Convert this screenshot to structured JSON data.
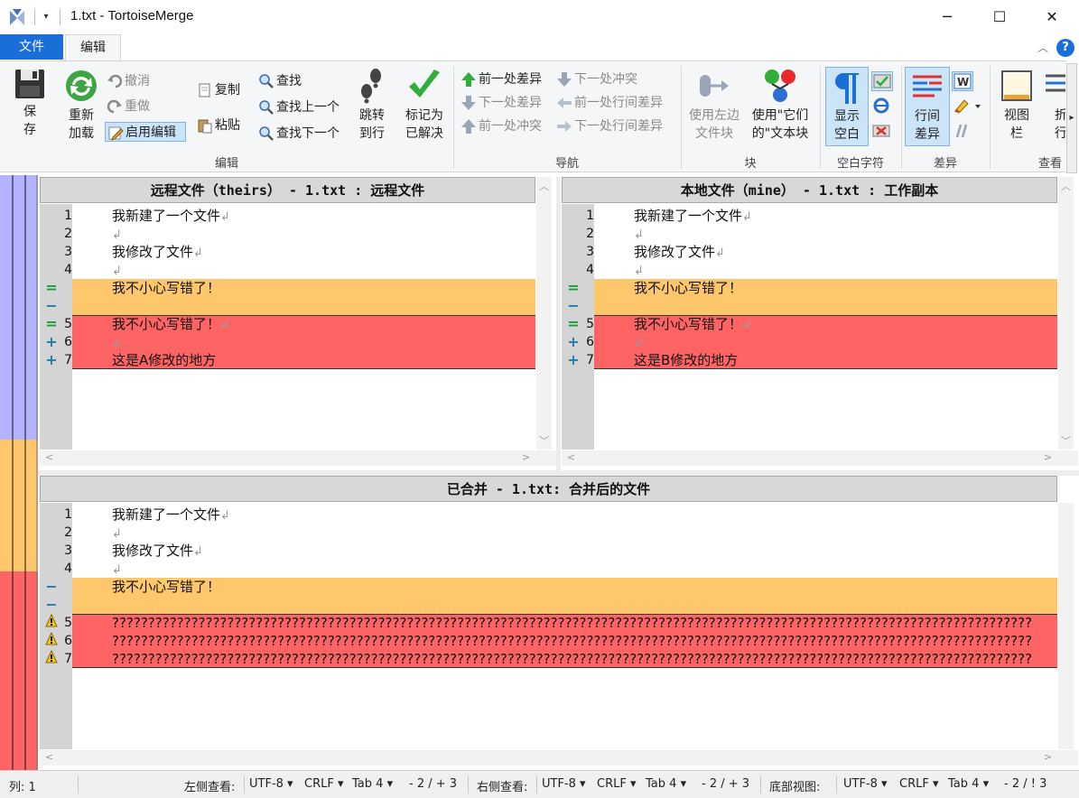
{
  "window": {
    "title": "1.txt - TortoiseMerge",
    "quick_access_dropdown": "▾",
    "minimize": "─",
    "maximize": "☐",
    "close": "✕"
  },
  "ribbon_tabs": {
    "file": "文件",
    "edit": "编辑",
    "help": "?"
  },
  "ribbon": {
    "edit_group": {
      "label": "编辑",
      "save": "保\n存",
      "reload": "重新\n加载",
      "undo": "撤消",
      "redo": "重做",
      "enable_edit": "启用编辑",
      "copy": "复制",
      "paste": "粘贴",
      "find": "查找",
      "find_prev": "查找上一个",
      "find_next": "查找下一个",
      "goto_line": "跳转\n到行",
      "mark_resolved": "标记为\n已解决"
    },
    "nav_group": {
      "label": "导航",
      "prev_diff": "前一处差异",
      "next_diff": "下一处差异",
      "prev_conflict": "前一处冲突",
      "next_conflict": "下一处冲突",
      "prev_inline_diff": "前一处行间差异",
      "next_inline_diff": "下一处行间差异"
    },
    "block_group": {
      "label": "块",
      "use_left": "使用左边\n文件块",
      "use_theirs": "使用\"它们\n的\"文本块"
    },
    "whitespace_group": {
      "label": "空白字符",
      "show_whitespace": "显示\n空白"
    },
    "diff_group": {
      "label": "差异",
      "inline_diff": "行间\n差异"
    },
    "view_group": {
      "label": "查看",
      "view_bar": "视图\n栏",
      "fold": "折\n行"
    }
  },
  "panes": {
    "left": {
      "header": "远程文件（theirs） - 1.txt : 远程文件",
      "lines": [
        {
          "mark": "",
          "num": "1",
          "text": "我新建了一个文件",
          "eol": "↲",
          "bg": ""
        },
        {
          "mark": "",
          "num": "2",
          "text": "",
          "eol": "↲",
          "bg": ""
        },
        {
          "mark": "",
          "num": "3",
          "text": "我修改了文件",
          "eol": "↲",
          "bg": ""
        },
        {
          "mark": "",
          "num": "4",
          "text": "",
          "eol": "↲",
          "bg": ""
        },
        {
          "mark": "=",
          "num": "",
          "text": "我不小心写错了！",
          "eol": "",
          "bg": "orange"
        },
        {
          "mark": "−",
          "num": "",
          "text": "",
          "eol": "",
          "bg": "orange"
        },
        {
          "mark": "=",
          "num": "5",
          "text": "我不小心写错了！",
          "eol": "↲",
          "bg": "red"
        },
        {
          "mark": "+",
          "num": "6",
          "text": "",
          "eol": "↲",
          "bg": "red"
        },
        {
          "mark": "+",
          "num": "7",
          "text": "这是A修改的地方",
          "eol": "",
          "bg": "red"
        }
      ]
    },
    "right": {
      "header": "本地文件（mine） - 1.txt : 工作副本",
      "lines": [
        {
          "mark": "",
          "num": "1",
          "text": "我新建了一个文件",
          "eol": "↲",
          "bg": ""
        },
        {
          "mark": "",
          "num": "2",
          "text": "",
          "eol": "↲",
          "bg": ""
        },
        {
          "mark": "",
          "num": "3",
          "text": "我修改了文件",
          "eol": "↲",
          "bg": ""
        },
        {
          "mark": "",
          "num": "4",
          "text": "",
          "eol": "↲",
          "bg": ""
        },
        {
          "mark": "=",
          "num": "",
          "text": "我不小心写错了！",
          "eol": "",
          "bg": "orange"
        },
        {
          "mark": "−",
          "num": "",
          "text": "",
          "eol": "",
          "bg": "orange"
        },
        {
          "mark": "=",
          "num": "5",
          "text": "我不小心写错了！",
          "eol": "↲",
          "bg": "red"
        },
        {
          "mark": "+",
          "num": "6",
          "text": "",
          "eol": "↲",
          "bg": "red"
        },
        {
          "mark": "+",
          "num": "7",
          "text": "这是B修改的地方",
          "eol": "",
          "bg": "red"
        }
      ]
    },
    "bottom": {
      "header": "已合并 - 1.txt: 合并后的文件",
      "lines": [
        {
          "mark": "",
          "num": "1",
          "text": "我新建了一个文件",
          "eol": "↲",
          "bg": ""
        },
        {
          "mark": "",
          "num": "2",
          "text": "",
          "eol": "↲",
          "bg": ""
        },
        {
          "mark": "",
          "num": "3",
          "text": "我修改了文件",
          "eol": "↲",
          "bg": ""
        },
        {
          "mark": "",
          "num": "4",
          "text": "",
          "eol": "↲",
          "bg": ""
        },
        {
          "mark": "−",
          "num": "",
          "text": "我不小心写错了！",
          "eol": "",
          "bg": "orange"
        },
        {
          "mark": "−",
          "num": "",
          "text": "",
          "eol": "",
          "bg": "orange"
        },
        {
          "mark": "!",
          "num": "5",
          "text": "????????????????????????????????????????????????????????????????????????????????????????????????????????????????????????????????",
          "eol": "",
          "bg": "red"
        },
        {
          "mark": "!",
          "num": "6",
          "text": "????????????????????????????????????????????????????????????????????????????????????????????????????????????????????????????????",
          "eol": "",
          "bg": "red"
        },
        {
          "mark": "!",
          "num": "7",
          "text": "????????????????????????????????????????????????????????????????????????????????????????????????????????????????????????????????",
          "eol": "",
          "bg": "red"
        }
      ]
    }
  },
  "statusbar": {
    "column": "列: 1",
    "left_view_label": "左侧查看:",
    "left_encoding": "UTF-8",
    "left_eol": "CRLF",
    "left_tab": "Tab 4",
    "left_diff": "- 2 / + 3",
    "right_view_label": "右侧查看:",
    "right_encoding": "UTF-8",
    "right_eol": "CRLF",
    "right_tab": "Tab 4",
    "right_diff": "- 2 / + 3",
    "bottom_view_label": "底部视图:",
    "bottom_encoding": "UTF-8",
    "bottom_eol": "CRLF",
    "bottom_tab": "Tab 4",
    "bottom_diff": "- 2 / ! 3"
  },
  "colors": {
    "accent": "#1a6ed8",
    "conflict_orange": "#ffc76b",
    "conflict_red": "#ff6464",
    "overview_blue": "#b3b3ff"
  }
}
